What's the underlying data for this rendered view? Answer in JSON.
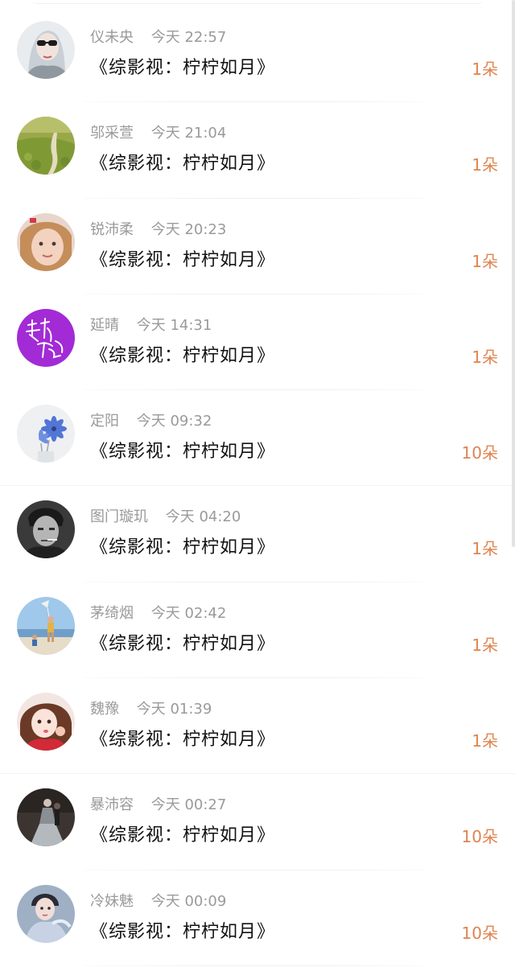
{
  "records": [
    {
      "name": "仪未央",
      "time": "今天 22:57",
      "title": "《综影视：柠柠如月》",
      "amount": "1朵",
      "avatar": "avatar-woman-sunglasses"
    },
    {
      "name": "邬采萱",
      "time": "今天 21:04",
      "title": "《综影视：柠柠如月》",
      "amount": "1朵",
      "avatar": "avatar-green-field"
    },
    {
      "name": "锐沛柔",
      "time": "今天 20:23",
      "title": "《综影视：柠柠如月》",
      "amount": "1朵",
      "avatar": "avatar-child"
    },
    {
      "name": "延晴",
      "time": "今天 14:31",
      "title": "《综影视：柠柠如月》",
      "amount": "1朵",
      "avatar": "avatar-purple-calligraphy"
    },
    {
      "name": "定阳",
      "time": "今天 09:32",
      "title": "《综影视：柠柠如月》",
      "amount": "10朵",
      "avatar": "avatar-blue-flowers"
    },
    {
      "name": "图门璇玑",
      "time": "今天 04:20",
      "title": "《综影视：柠柠如月》",
      "amount": "1朵",
      "avatar": "avatar-man-bw"
    },
    {
      "name": "茅绮烟",
      "time": "今天 02:42",
      "title": "《综影视：柠柠如月》",
      "amount": "1朵",
      "avatar": "avatar-beach-kite"
    },
    {
      "name": "魏豫",
      "time": "今天 01:39",
      "title": "《综影视：柠柠如月》",
      "amount": "1朵",
      "avatar": "avatar-girl-red"
    },
    {
      "name": "暴沛容",
      "time": "今天 00:27",
      "title": "《综影视：柠柠如月》",
      "amount": "10朵",
      "avatar": "avatar-dark-gown"
    },
    {
      "name": "冷妹魅",
      "time": "今天 00:09",
      "title": "《综影视：柠柠如月》",
      "amount": "10朵",
      "avatar": "avatar-costume-lady"
    }
  ],
  "colors": {
    "amount": "#e0834f",
    "meta": "#9a9a9a",
    "title": "#111111"
  }
}
